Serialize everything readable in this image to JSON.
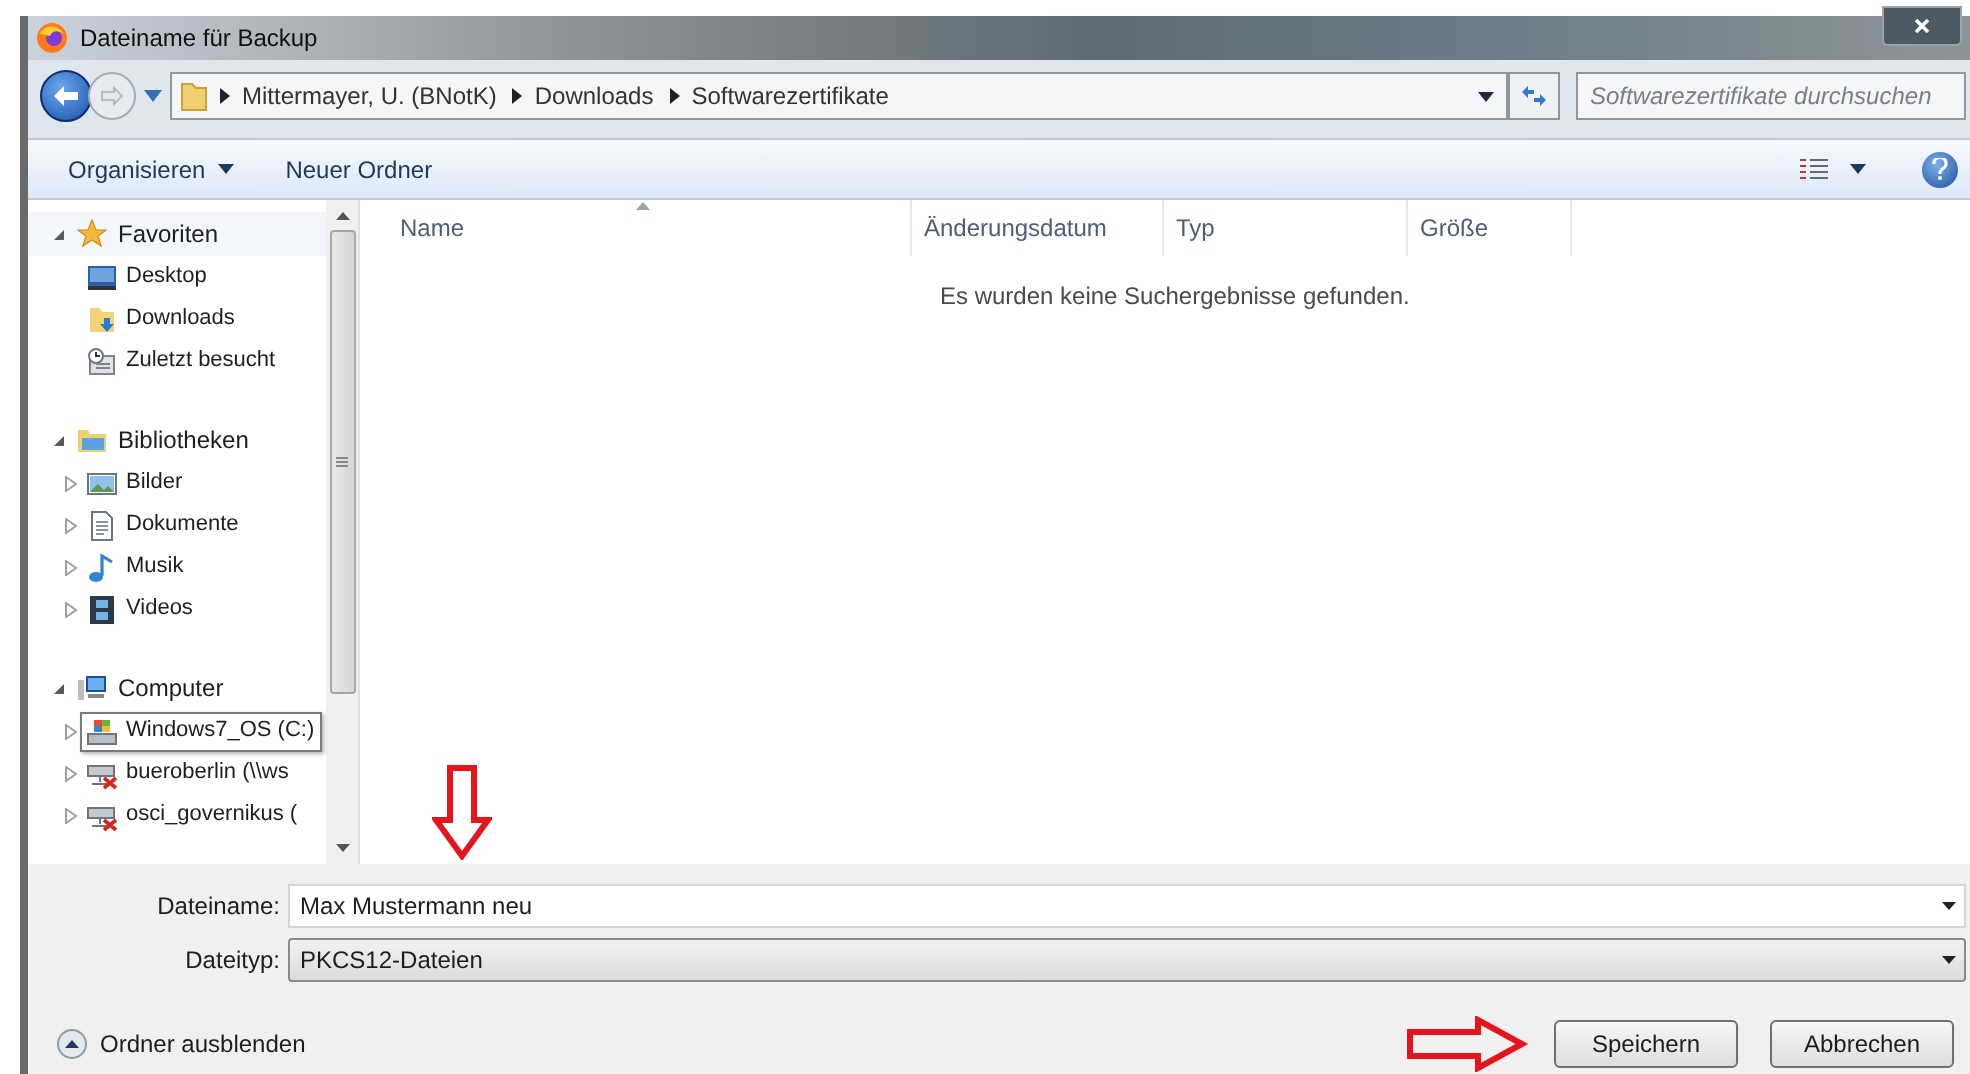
{
  "window": {
    "title": "Dateiname für Backup"
  },
  "address_bar": {
    "breadcrumbs": [
      "Mittermayer, U. (BNotK)",
      "Downloads",
      "Softwarezertifikate"
    ]
  },
  "search": {
    "placeholder": "Softwarezertifikate durchsuchen"
  },
  "toolbar": {
    "buttons": [
      {
        "label": "Organisieren",
        "kind": "menu"
      },
      {
        "label": "Neuer Ordner",
        "kind": "plain"
      }
    ]
  },
  "sidebar": {
    "items": [
      {
        "label": "Favoriten",
        "kind": "favorites",
        "expanded": true,
        "children": [
          {
            "label": "Desktop",
            "kind": "desktop"
          },
          {
            "label": "Downloads",
            "kind": "downloads"
          },
          {
            "label": "Zuletzt besucht",
            "kind": "recent"
          }
        ]
      },
      {
        "label": "Bibliotheken",
        "kind": "libraries",
        "expanded": true,
        "children": [
          {
            "label": "Bilder",
            "kind": "pictures",
            "expanded": false
          },
          {
            "label": "Dokumente",
            "kind": "documents",
            "expanded": false
          },
          {
            "label": "Musik",
            "kind": "music",
            "expanded": false
          },
          {
            "label": "Videos",
            "kind": "videos",
            "expanded": false
          }
        ]
      },
      {
        "label": "Computer",
        "kind": "computer",
        "expanded": true,
        "children": [
          {
            "label": "Windows7_OS (C:)",
            "kind": "drive",
            "expanded": false,
            "selected": true
          },
          {
            "label": "bueroberlin (\\\\ws",
            "kind": "network-drive",
            "expanded": false,
            "selected": false
          },
          {
            "label": "osci_governikus (",
            "kind": "network-drive",
            "expanded": false,
            "selected": false
          }
        ]
      }
    ]
  },
  "table": {
    "columns": [
      "Name",
      "Änderungsdatum",
      "Typ",
      "Größe"
    ],
    "empty_message": "Es wurden keine Suchergebnisse gefunden."
  },
  "form": {
    "fields": [
      {
        "label": "Dateiname:",
        "value": "Max Mustermann neu",
        "kind": "edit"
      },
      {
        "label": "Dateityp:",
        "value": "PKCS12-Dateien",
        "kind": "select"
      }
    ]
  },
  "footer": {
    "toggle": "Ordner ausblenden",
    "buttons": [
      "Speichern",
      "Abbrechen"
    ]
  }
}
